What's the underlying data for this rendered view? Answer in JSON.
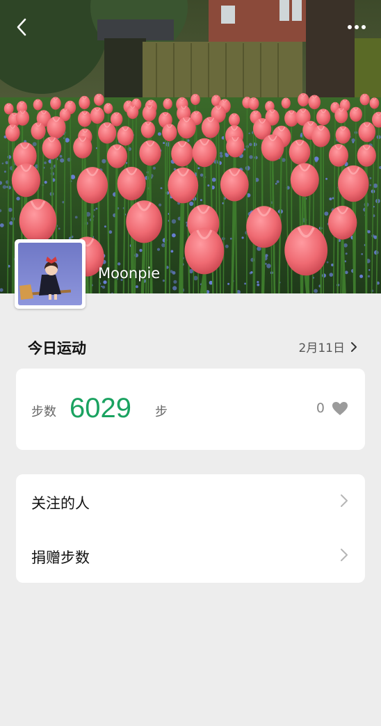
{
  "profile": {
    "username": "Moonpie"
  },
  "section": {
    "title": "今日运动",
    "date": "2月11日"
  },
  "steps": {
    "label": "步数",
    "value": "6029",
    "unit": "步",
    "likes": "0"
  },
  "menu": {
    "items": [
      {
        "label": "关注的人"
      },
      {
        "label": "捐赠步数"
      }
    ]
  },
  "colors": {
    "background": "#ededed",
    "card": "#ffffff",
    "steps_green": "#1aa260",
    "tulip": "#f06a77"
  },
  "icons": {
    "back": "chevron-left-icon",
    "more": "more-dots-icon",
    "date_arrow": "chevron-right-icon",
    "like": "heart-icon",
    "menu_arrow": "chevron-right-icon"
  }
}
